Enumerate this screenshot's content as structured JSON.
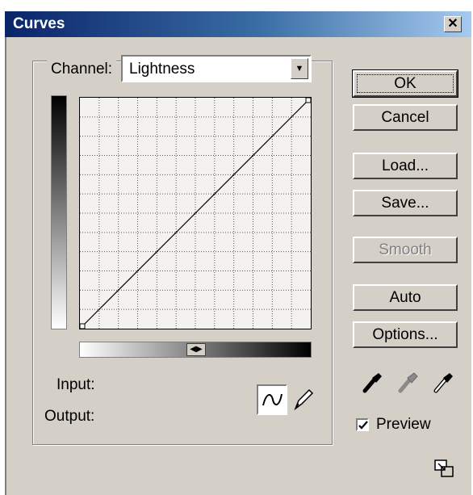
{
  "window": {
    "title": "Curves",
    "close_glyph": "✕"
  },
  "channel": {
    "label": "Channel:",
    "value": "Lightness"
  },
  "curve": {
    "grid_divisions": 12,
    "points": [
      [
        0,
        0
      ],
      [
        255,
        255
      ]
    ]
  },
  "labels": {
    "input": "Input:",
    "output": "Output:"
  },
  "buttons": {
    "ok": "OK",
    "cancel": "Cancel",
    "load": "Load...",
    "save": "Save...",
    "smooth": "Smooth",
    "auto": "Auto",
    "options": "Options..."
  },
  "preview": {
    "label": "Preview",
    "checked": true
  },
  "icons": [
    "curve-tool-icon",
    "pencil-tool-icon",
    "black-eyedropper-icon",
    "gray-eyedropper-icon",
    "white-eyedropper-icon",
    "resize-icon"
  ],
  "colors": {
    "title_start": "#0a246a",
    "title_end": "#a6caf0",
    "face": "#d4d0c8"
  }
}
